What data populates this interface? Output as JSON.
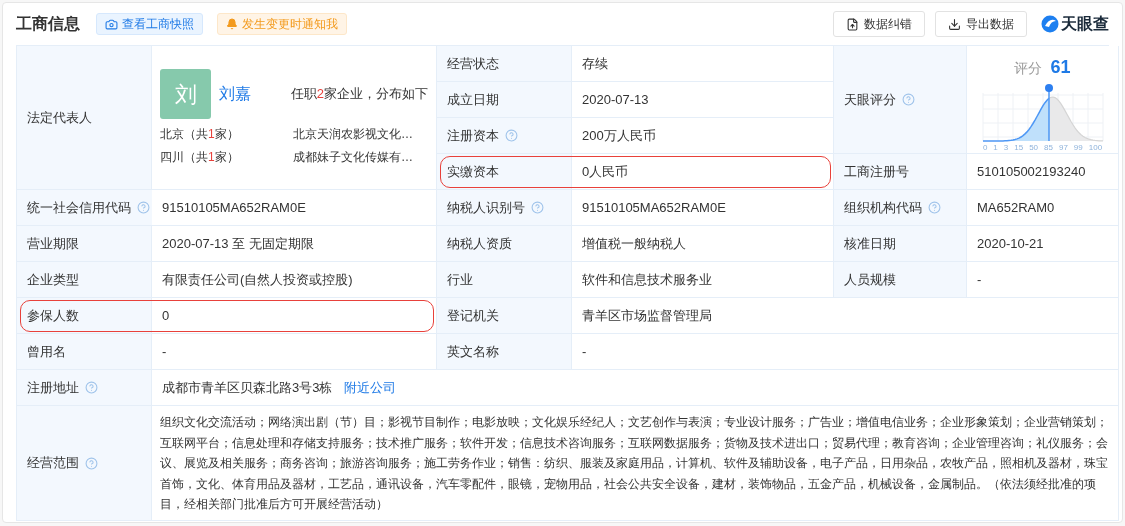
{
  "header": {
    "title": "工商信息",
    "snapshot_button": "查看工商快照",
    "notify_button": "发生变更时通知我",
    "correct_button": "数据纠错",
    "export_button": "导出数据",
    "logo_text": "天眼查"
  },
  "legal_rep": {
    "label": "法定代表人",
    "help": false,
    "avatar": "刘",
    "name": "刘嘉",
    "summary_prefix": "任职",
    "summary_count": "2",
    "summary_suffix": "家企业，分布如下",
    "regions": [
      {
        "prefix": "北京（共",
        "count": "1",
        "suffix": "家）",
        "company": "北京天润农影视文化…"
      },
      {
        "prefix": "四川（共",
        "count": "1",
        "suffix": "家）",
        "company": "成都妹子文化传媒有…"
      }
    ]
  },
  "mid_fields": [
    {
      "label": "经营状态",
      "help": false,
      "value": "存续",
      "highlighted": false
    },
    {
      "label": "成立日期",
      "help": false,
      "value": "2020-07-13",
      "highlighted": false
    },
    {
      "label": "注册资本",
      "help": true,
      "value": "200万人民币",
      "highlighted": false
    },
    {
      "label": "实缴资本",
      "help": false,
      "value": "0人民币",
      "highlighted": true
    }
  ],
  "score": {
    "label": "天眼评分",
    "help": true,
    "caption": "评分",
    "value": "61",
    "axis_labels": [
      "0",
      "1",
      "3",
      "15",
      "50",
      "85",
      "97",
      "99",
      "100"
    ]
  },
  "reg_number": {
    "label": "工商注册号",
    "help": false,
    "value": "510105002193240"
  },
  "rows": [
    [
      {
        "label": "统一社会信用代码",
        "help": true,
        "value": "91510105MA652RAM0E",
        "highlighted": false
      },
      {
        "label": "纳税人识别号",
        "help": true,
        "value": "91510105MA652RAM0E",
        "highlighted": false
      },
      {
        "label": "组织机构代码",
        "help": true,
        "value": "MA652RAM0",
        "highlighted": false
      }
    ],
    [
      {
        "label": "营业期限",
        "help": false,
        "value": "2020-07-13 至 无固定期限",
        "highlighted": false
      },
      {
        "label": "纳税人资质",
        "help": false,
        "value": "增值税一般纳税人",
        "highlighted": false
      },
      {
        "label": "核准日期",
        "help": false,
        "value": "2020-10-21",
        "highlighted": false
      }
    ],
    [
      {
        "label": "企业类型",
        "help": false,
        "value": "有限责任公司(自然人投资或控股)",
        "highlighted": false
      },
      {
        "label": "行业",
        "help": false,
        "value": "软件和信息技术服务业",
        "highlighted": false
      },
      {
        "label": "人员规模",
        "help": false,
        "value": "-",
        "highlighted": false
      }
    ],
    [
      {
        "label": "参保人数",
        "help": false,
        "value": "0",
        "highlighted": true
      },
      {
        "label": "登记机关",
        "help": false,
        "value": "青羊区市场监督管理局",
        "highlighted": false
      }
    ],
    [
      {
        "label": "曾用名",
        "help": false,
        "value": "-",
        "highlighted": false
      },
      {
        "label": "英文名称",
        "help": false,
        "value": "-",
        "highlighted": false
      }
    ]
  ],
  "address": {
    "label": "注册地址",
    "help": true,
    "value": "成都市青羊区贝森北路3号3栋",
    "link": "附近公司"
  },
  "scope": {
    "label": "经营范围",
    "help": true,
    "value": "组织文化交流活动；网络演出剧（节）目；影视节目制作；电影放映；文化娱乐经纪人；文艺创作与表演；专业设计服务；广告业；增值电信业务；企业形象策划；企业营销策划；互联网平台；信息处理和存储支持服务；技术推广服务；软件开发；信息技术咨询服务；互联网数据服务；货物及技术进出口；贸易代理；教育咨询；企业管理咨询；礼仪服务；会议、展览及相关服务；商务咨询；旅游咨询服务；施工劳务作业；销售：纺织、服装及家庭用品，计算机、软件及辅助设备，电子产品，日用杂品，农牧产品，照相机及器材，珠宝首饰，文化、体育用品及器材，工艺品，通讯设备，汽车零配件，眼镜，宠物用品，社会公共安全设备，建材，装饰物品，五金产品，机械设备，金属制品。（依法须经批准的项目，经相关部门批准后方可开展经营活动）"
  }
}
